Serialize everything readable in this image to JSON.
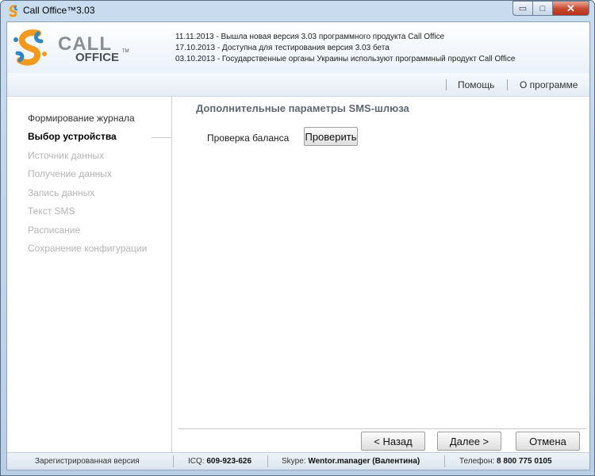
{
  "window": {
    "title": "Call Office™3.03",
    "minimize_symbol": "▭",
    "maximize_symbol": "□",
    "close_symbol": "✕"
  },
  "header": {
    "logo_call": "CALL",
    "logo_office": "OFFICE",
    "logo_tm": "TM",
    "news": [
      "11.11.2013 - Вышла новая версия 3.03 программного продукта Call Office",
      "17.10.2013 - Доступна для тестирования версия 3.03 бета",
      "03.10.2013 - Государственные органы Украины используют программный продукт Call Office"
    ]
  },
  "menu": {
    "help": "Помощь",
    "about": "О программе"
  },
  "sidebar": {
    "steps": [
      {
        "label": "Формирование журнала",
        "state": "done"
      },
      {
        "label": "Выбор устройства",
        "state": "current"
      },
      {
        "label": "Источник данных",
        "state": "pending"
      },
      {
        "label": "Получение данных",
        "state": "pending"
      },
      {
        "label": "Запись данных",
        "state": "pending"
      },
      {
        "label": "Текст SMS",
        "state": "pending"
      },
      {
        "label": "Расписание",
        "state": "pending"
      },
      {
        "label": "Сохранение конфигурации",
        "state": "pending"
      }
    ]
  },
  "main": {
    "title": "Дополнительные параметры SMS-шлюза",
    "balance_label": "Проверка баланса",
    "check_button": "Проверить"
  },
  "nav": {
    "back": "< Назад",
    "next": "Далее >",
    "cancel": "Отмена"
  },
  "status": {
    "registered": "Зарегистрированная версия",
    "icq_label": "ICQ:",
    "icq_value": "609-923-626",
    "skype_label": "Skype:",
    "skype_value": "Wentor.manager (Валентина)",
    "phone_label": "Телефон:",
    "phone_value": "8 800 775 0105"
  },
  "colors": {
    "accent_orange": "#f39a1e",
    "accent_blue": "#2f86c8",
    "close_red": "#c9452c"
  }
}
